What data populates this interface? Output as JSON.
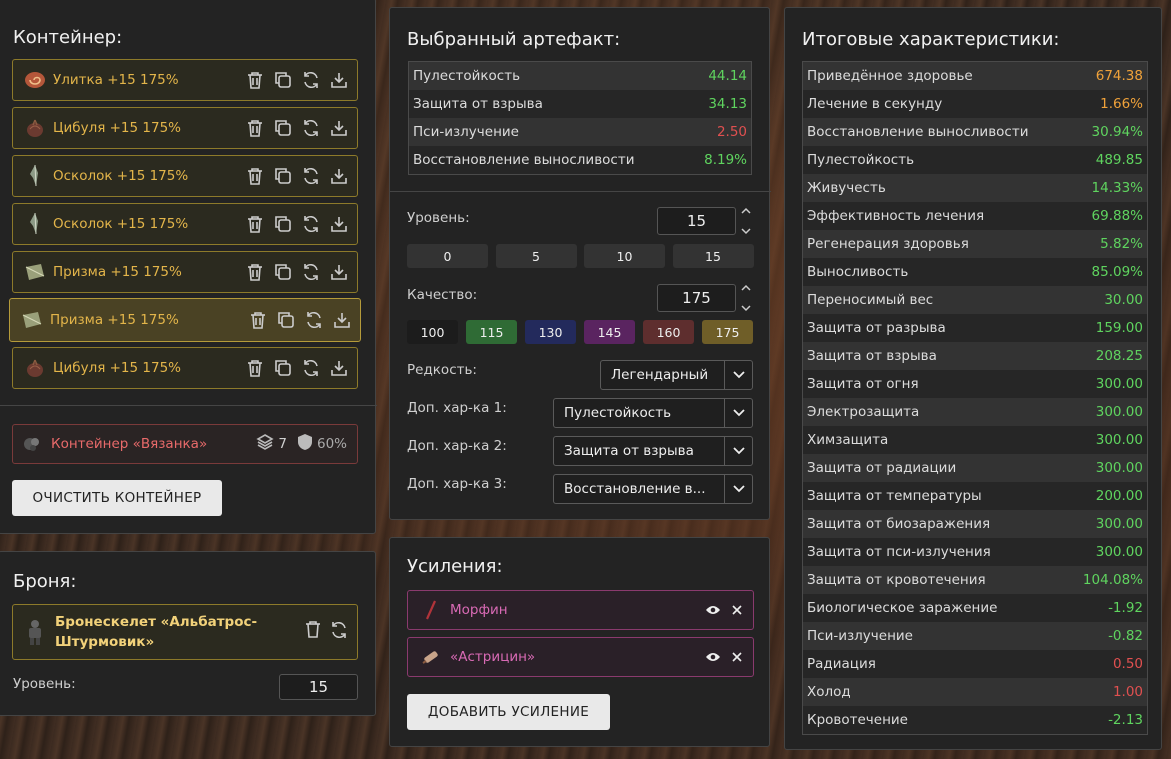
{
  "container": {
    "title": "Контейнер:",
    "items": [
      {
        "label": "Улитка +15 175%",
        "icon": "snail-artifact-icon"
      },
      {
        "label": "Цибуля +15 175%",
        "icon": "onion-artifact-icon"
      },
      {
        "label": "Осколок +15 175%",
        "icon": "shard-artifact-icon"
      },
      {
        "label": "Осколок +15 175%",
        "icon": "shard-artifact-icon"
      },
      {
        "label": "Призма +15 175%",
        "icon": "prism-artifact-icon"
      },
      {
        "label": "Призма +15 175%",
        "icon": "prism-artifact-icon"
      },
      {
        "label": "Цибуля +15 175%",
        "icon": "onion-artifact-icon"
      }
    ],
    "summary": {
      "label": "Контейнер «Вязанка»",
      "slots": "7",
      "protection": "60%"
    },
    "clear_button": "ОЧИСТИТЬ КОНТЕЙНЕР"
  },
  "armor": {
    "title": "Броня:",
    "item_line1": "Бронескелет «Альбатрос-",
    "item_line2": "Штурмовик»",
    "level_label": "Уровень:",
    "level_value": "15"
  },
  "artifact": {
    "title": "Выбранный артефакт:",
    "stats": [
      {
        "name": "Пулестойкость",
        "value": "44.14",
        "color": "green"
      },
      {
        "name": "Защита от взрыва",
        "value": "34.13",
        "color": "green"
      },
      {
        "name": "Пси-излучение",
        "value": "2.50",
        "color": "red"
      },
      {
        "name": "Восстановление выносливости",
        "value": "8.19%",
        "color": "green"
      }
    ],
    "level_label": "Уровень:",
    "level_value": "15",
    "level_presets": [
      "0",
      "5",
      "10",
      "15"
    ],
    "quality_label": "Качество:",
    "quality_value": "175",
    "quality_presets": [
      {
        "label": "100",
        "color": "#1c1c1c"
      },
      {
        "label": "115",
        "color": "#2f6b35"
      },
      {
        "label": "130",
        "color": "#232a5c"
      },
      {
        "label": "145",
        "color": "#5a2460"
      },
      {
        "label": "160",
        "color": "#5e2e2e"
      },
      {
        "label": "175",
        "color": "#6f5e28"
      }
    ],
    "rarity_label": "Редкость:",
    "rarity_value": "Легендарный",
    "extra1_label": "Доп. хар-ка 1:",
    "extra1_value": "Пулестойкость",
    "extra2_label": "Доп. хар-ка 2:",
    "extra2_value": "Защита от взрыва",
    "extra3_label": "Доп. хар-ка 3:",
    "extra3_value": "Восстановление в..."
  },
  "boosts": {
    "title": "Усиления:",
    "items": [
      {
        "label": "Морфин",
        "icon": "syringe-icon"
      },
      {
        "label": "«Астрицин»",
        "icon": "injector-icon"
      }
    ],
    "add_button": "ДОБАВИТЬ УСИЛЕНИЕ"
  },
  "totals": {
    "title": "Итоговые характеристики:",
    "rows": [
      {
        "name": "Приведённое здоровье",
        "value": "674.38",
        "color": "orange"
      },
      {
        "name": "Лечение в секунду",
        "value": "1.66%",
        "color": "orange"
      },
      {
        "name": "Восстановление выносливости",
        "value": "30.94%",
        "color": "green"
      },
      {
        "name": "Пулестойкость",
        "value": "489.85",
        "color": "green"
      },
      {
        "name": "Живучесть",
        "value": "14.33%",
        "color": "green"
      },
      {
        "name": "Эффективность лечения",
        "value": "69.88%",
        "color": "green"
      },
      {
        "name": "Регенерация здоровья",
        "value": "5.82%",
        "color": "green"
      },
      {
        "name": "Выносливость",
        "value": "85.09%",
        "color": "green"
      },
      {
        "name": "Переносимый вес",
        "value": "30.00",
        "color": "green"
      },
      {
        "name": "Защита от разрыва",
        "value": "159.00",
        "color": "green"
      },
      {
        "name": "Защита от взрыва",
        "value": "208.25",
        "color": "green"
      },
      {
        "name": "Защита от огня",
        "value": "300.00",
        "color": "green"
      },
      {
        "name": "Электрозащита",
        "value": "300.00",
        "color": "green"
      },
      {
        "name": "Химзащита",
        "value": "300.00",
        "color": "green"
      },
      {
        "name": "Защита от радиации",
        "value": "300.00",
        "color": "green"
      },
      {
        "name": "Защита от температуры",
        "value": "200.00",
        "color": "green"
      },
      {
        "name": "Защита от биозаражения",
        "value": "300.00",
        "color": "green"
      },
      {
        "name": "Защита от пси-излучения",
        "value": "300.00",
        "color": "green"
      },
      {
        "name": "Защита от кровотечения",
        "value": "104.08%",
        "color": "green"
      },
      {
        "name": "Биологическое заражение",
        "value": "-1.92",
        "color": "green"
      },
      {
        "name": "Пси-излучение",
        "value": "-0.82",
        "color": "green"
      },
      {
        "name": "Радиация",
        "value": "0.50",
        "color": "red"
      },
      {
        "name": "Холод",
        "value": "1.00",
        "color": "red"
      },
      {
        "name": "Кровотечение",
        "value": "-2.13",
        "color": "green"
      }
    ]
  }
}
